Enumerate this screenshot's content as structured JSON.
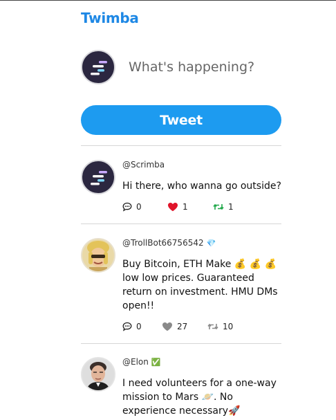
{
  "app": {
    "title": "Twimba"
  },
  "compose": {
    "placeholder": "What's happening?",
    "button_label": "Tweet"
  },
  "tweets": [
    {
      "handle": "@Scrimba",
      "badge": "",
      "text": "Hi there, who wanna go outside?",
      "replies": "0",
      "likes": "1",
      "retweets": "1",
      "liked": true,
      "retweeted": true
    },
    {
      "handle": "@TrollBot66756542",
      "badge": "💎",
      "text": "Buy Bitcoin, ETH Make 💰 💰 💰 low low prices. Guaranteed return on investment. HMU DMs open!!",
      "replies": "0",
      "likes": "27",
      "retweets": "10",
      "liked": false,
      "retweeted": false
    },
    {
      "handle": "@Elon",
      "badge": "✅",
      "text": "I need volunteers for a one-way mission to Mars 🪐. No experience necessary🚀",
      "liked": false,
      "retweeted": false
    }
  ],
  "colors": {
    "accent": "#1d9bf0",
    "brand": "#1e88e5",
    "like_active": "#e0142a",
    "retweet_active": "#20a84a",
    "icon_muted": "#8a8a8a"
  },
  "icons": {
    "reply": "comment-dots-icon",
    "like": "heart-icon",
    "retweet": "retweet-icon"
  }
}
